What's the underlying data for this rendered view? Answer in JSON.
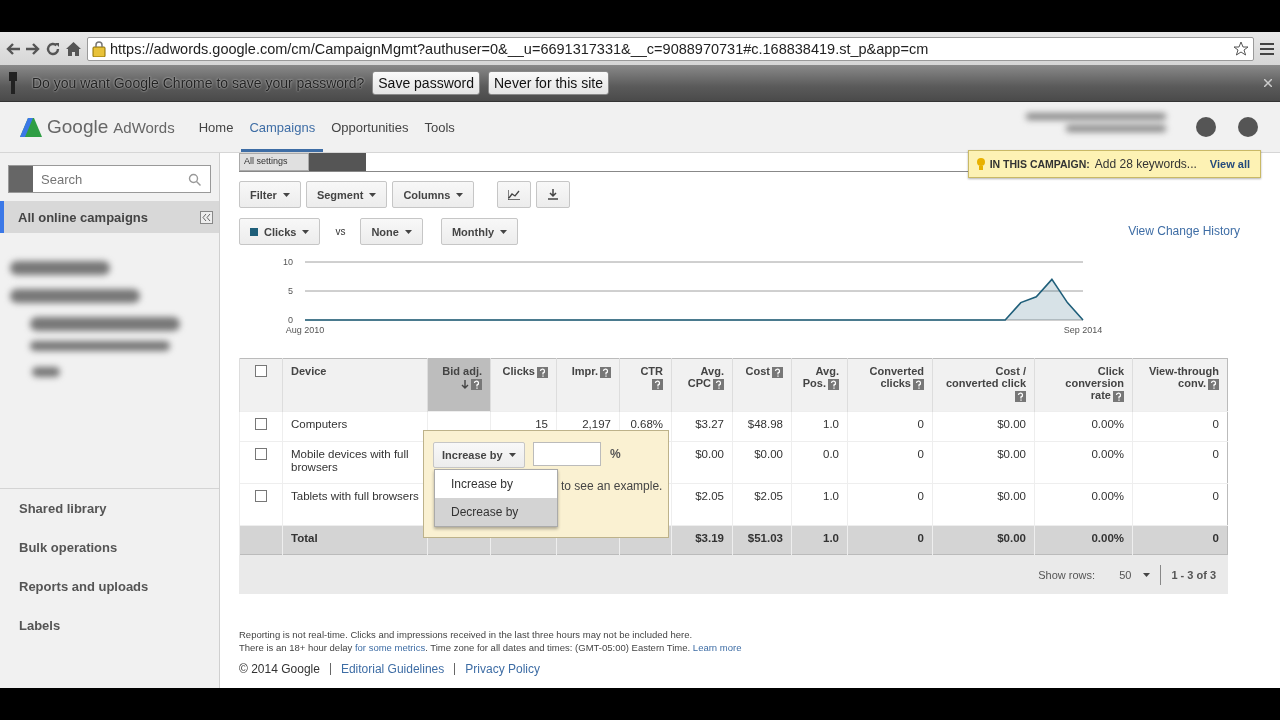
{
  "browser": {
    "url": "https://adwords.google.com/cm/CampaignMgmt?authuser=0&__u=6691317331&__c=9088970731#c.168838419.st_p&app=cm"
  },
  "infobar": {
    "message": "Do you want Google Chrome to save your password?",
    "buttons": [
      "Save password",
      "Never for this site"
    ]
  },
  "header": {
    "logo_google": "Google",
    "logo_product": "AdWords",
    "nav": [
      {
        "label": "Home",
        "selected": false
      },
      {
        "label": "Campaigns",
        "selected": true
      },
      {
        "label": "Opportunities",
        "selected": false
      },
      {
        "label": "Tools",
        "selected": false
      }
    ],
    "tip": {
      "label": "IN THIS CAMPAIGN:",
      "text": "Add 28 keywords...",
      "link": "View all"
    }
  },
  "sidebar": {
    "search_placeholder": "Search",
    "all_campaigns": "All online campaigns",
    "links": [
      "Shared library",
      "Bulk operations",
      "Reports and uploads",
      "Labels"
    ]
  },
  "main": {
    "tabs": [
      {
        "label": "All settings",
        "selected": false
      }
    ],
    "toolbar": [
      "Filter",
      "Segment",
      "Columns"
    ],
    "metrics": {
      "vs": "vs",
      "metric2": "None",
      "period": "Monthly"
    },
    "history_link": "View Change History",
    "chart_data": {
      "type": "area",
      "categories": [
        "Aug 2010",
        null,
        null,
        null,
        null,
        null,
        null,
        null,
        null,
        null,
        null,
        null,
        null,
        null,
        null,
        null,
        null,
        null,
        null,
        null,
        null,
        null,
        null,
        null,
        null,
        null,
        null,
        null,
        null,
        null,
        null,
        null,
        null,
        null,
        null,
        null,
        null,
        null,
        null,
        null,
        null,
        null,
        null,
        null,
        null,
        null,
        null,
        null,
        null,
        null,
        "Sep 2014"
      ],
      "series": [
        {
          "name": "Clicks",
          "color": "#1f5f7a",
          "values": [
            0,
            0,
            0,
            0,
            0,
            0,
            0,
            0,
            0,
            0,
            0,
            0,
            0,
            0,
            0,
            0,
            0,
            0,
            0,
            0,
            0,
            0,
            0,
            0,
            0,
            0,
            0,
            0,
            0,
            0,
            0,
            0,
            0,
            0,
            0,
            0,
            0,
            0,
            0,
            0,
            0,
            0,
            0,
            0,
            0,
            0,
            3,
            4,
            7,
            3,
            0
          ]
        }
      ],
      "ylim": [
        0,
        10
      ],
      "yticks": [
        0,
        5,
        10
      ]
    },
    "table": {
      "select_all": {
        "checked": false
      },
      "columns": [
        {
          "label": "Device",
          "help": false,
          "sorted": false
        },
        {
          "label": "Bid adj.",
          "help": true,
          "sorted": true
        },
        {
          "label": "Clicks",
          "help": true,
          "sorted": false
        },
        {
          "label": "Impr.",
          "help": true,
          "sorted": false
        },
        {
          "label": "CTR",
          "help": true,
          "sorted": false
        },
        {
          "label": "Avg. CPC",
          "help": true,
          "sorted": false
        },
        {
          "label": "Cost",
          "help": true,
          "sorted": false
        },
        {
          "label": "Avg. Pos.",
          "help": true,
          "sorted": false
        },
        {
          "label": "Converted clicks",
          "help": true,
          "sorted": false
        },
        {
          "label": "Cost / converted click",
          "help": true,
          "sorted": false
        },
        {
          "label": "Click conversion rate",
          "help": true,
          "sorted": false
        },
        {
          "label": "View-through conv.",
          "help": true,
          "sorted": false
        }
      ],
      "rows": [
        {
          "checked": false,
          "cells": [
            "Computers",
            "",
            "15",
            "2,197",
            "0.68%",
            "$3.27",
            "$48.98",
            "1.0",
            "0",
            "$0.00",
            "0.00%",
            "0"
          ]
        },
        {
          "checked": false,
          "cells": [
            "Mobile devices with full browsers",
            "",
            "",
            "",
            "",
            "$0.00",
            "$0.00",
            "0.0",
            "0",
            "$0.00",
            "0.00%",
            "0"
          ]
        },
        {
          "checked": false,
          "cells": [
            "Tablets with full browsers",
            "",
            "",
            "",
            "",
            "$2.05",
            "$2.05",
            "1.0",
            "0",
            "$0.00",
            "0.00%",
            "0"
          ]
        }
      ],
      "total": {
        "label": "Total",
        "values": [
          "$3.19",
          "$51.03",
          "1.0",
          "0",
          "$0.00",
          "0.00%",
          "0"
        ]
      }
    },
    "popup": {
      "select": "Increase by",
      "unit": "%",
      "hint": "to see an example.",
      "options": [
        {
          "label": "Increase by",
          "selected": false
        },
        {
          "label": "Decrease by",
          "selected": true
        }
      ]
    },
    "pagination": {
      "label": "Show rows:",
      "value": "50",
      "range": "1 - 3 of 3"
    },
    "footer": {
      "note1": "Reporting is not real-time. Clicks and impressions received in the last three hours may not be included here.",
      "note2_a": "There is an 18+ hour delay",
      "note2_link": "for some metrics",
      "note2_b": ". Time zone for all dates and times: (GMT-05:00) Eastern Time.",
      "learn_more": "Learn more",
      "copyright": "© 2014 Google",
      "links": [
        "Editorial Guidelines",
        "Privacy Policy"
      ]
    }
  }
}
